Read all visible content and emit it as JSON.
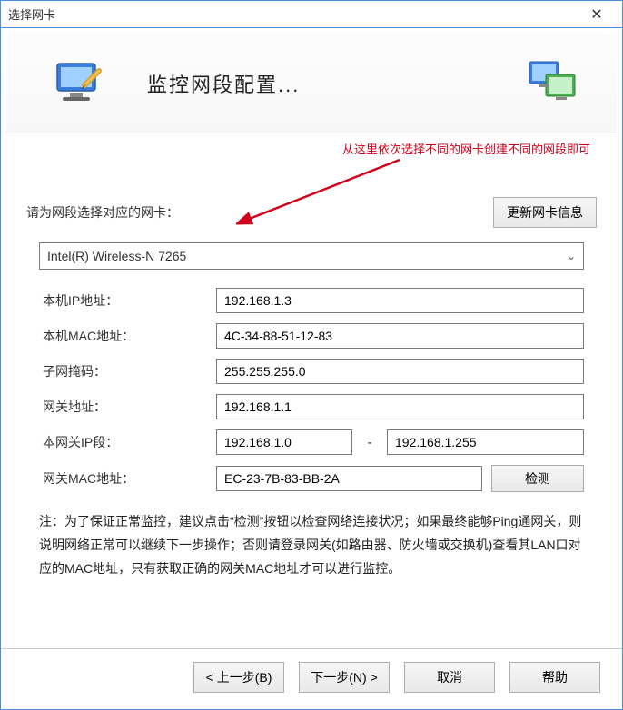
{
  "window": {
    "title": "选择网卡"
  },
  "banner": {
    "title": "监控网段配置..."
  },
  "annotation": {
    "text": "从这里依次选择不同的网卡创建不同的网段即可"
  },
  "form": {
    "prompt": "请为网段选择对应的网卡：",
    "refresh_button": "更新网卡信息",
    "adapter_selected": "Intel(R) Wireless-N 7265",
    "rows": {
      "local_ip": {
        "label": "本机IP地址：",
        "value": "192.168.1.3"
      },
      "local_mac": {
        "label": "本机MAC地址：",
        "value": "4C-34-88-51-12-83"
      },
      "subnet": {
        "label": "子网掩码：",
        "value": "255.255.255.0"
      },
      "gateway": {
        "label": "网关地址：",
        "value": "192.168.1.1"
      },
      "ip_range": {
        "label": "本网关IP段：",
        "start": "192.168.1.0",
        "end": "192.168.1.255"
      },
      "gateway_mac": {
        "label": "网关MAC地址：",
        "value": "EC-23-7B-83-BB-2A",
        "detect_button": "检测"
      }
    },
    "note": "注：为了保证正常监控，建议点击“检测”按钮以检查网络连接状况；如果最终能够Ping通网关，则说明网络正常可以继续下一步操作；否则请登录网关(如路由器、防火墙或交换机)查看其LAN口对应的MAC地址，只有获取正确的网关MAC地址才可以进行监控。"
  },
  "footer": {
    "back": "< 上一步(B)",
    "next": "下一步(N) >",
    "cancel": "取消",
    "help": "帮助"
  }
}
